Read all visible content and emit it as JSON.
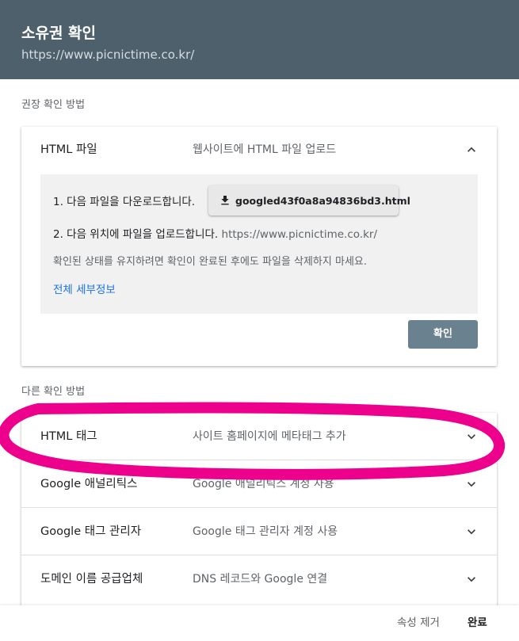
{
  "dialog": {
    "title": "소유권 확인",
    "url": "https://www.picnictime.co.kr/"
  },
  "recommended": {
    "section_label": "권장 확인 방법",
    "method": {
      "name": "HTML 파일",
      "description": "웹사이트에 HTML 파일 업로드",
      "chevron_icon": "chevron-up-icon",
      "step1": "1. 다음 파일을 다운로드합니다.",
      "download_icon": "download-icon",
      "download_file": "googled43f0a8a94836bd3.html",
      "step2": "2. 다음 위치에 파일을 업로드합니다.",
      "step2_url": "https://www.picnictime.co.kr/",
      "note": "확인된 상태를 유지하려면 확인이 완료된 후에도 파일을 삭제하지 마세요.",
      "details_link": "전체 세부정보",
      "confirm_button": "확인"
    }
  },
  "other": {
    "section_label": "다른 확인 방법",
    "items": [
      {
        "name": "HTML 태그",
        "description": "사이트 홈페이지에 메타태그 추가",
        "icon": "chevron-down-icon"
      },
      {
        "name": "Google 애널리틱스",
        "description": "Google 애널리틱스 계정 사용",
        "icon": "chevron-down-icon"
      },
      {
        "name": "Google 태그 관리자",
        "description": "Google 태그 관리자 계정 사용",
        "icon": "chevron-down-icon"
      },
      {
        "name": "도메인 이름 공급업체",
        "description": "DNS 레코드와 Google 연결",
        "icon": "chevron-down-icon"
      }
    ]
  },
  "footer": {
    "remove_label": "속성 제거",
    "done_label": "완료"
  },
  "colors": {
    "header_bg": "#4e606c",
    "confirm_button_bg": "#6a8190",
    "link": "#1a73e8",
    "annotation": "#ec008c"
  }
}
